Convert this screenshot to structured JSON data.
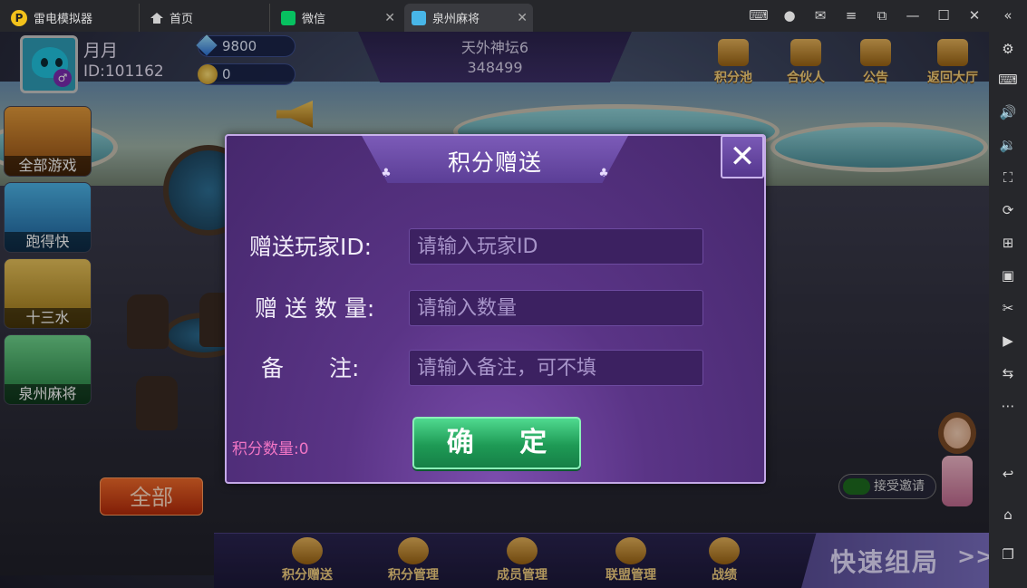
{
  "titlebar": {
    "tabs": [
      {
        "label": "雷电模拟器",
        "icon": "ldplayer-logo-icon"
      },
      {
        "label": "首页",
        "icon": "home-icon"
      },
      {
        "label": "微信",
        "icon": "wechat-icon"
      },
      {
        "label": "泉州麻将",
        "icon": "game-icon"
      }
    ]
  },
  "player": {
    "name": "月月",
    "id": "ID:101162",
    "diamonds": "9800",
    "coins": "0"
  },
  "room": {
    "name": "天外神坛6",
    "number": "348499"
  },
  "top_buttons": [
    "积分池",
    "合伙人",
    "公告",
    "返回大厅"
  ],
  "games": [
    "全部游戏",
    "跑得快",
    "十三水",
    "泉州麻将"
  ],
  "all_button": "全部",
  "dialog": {
    "title": "积分赠送",
    "close": "✕",
    "fields": [
      {
        "label": "赠送玩家ID:",
        "placeholder": "请输入玩家ID"
      },
      {
        "label": "赠 送 数 量:",
        "placeholder": "请输入数量"
      },
      {
        "label": "备　　注:",
        "placeholder": "请输入备注，可不填"
      }
    ],
    "points": "积分数量:0",
    "confirm": "确 定"
  },
  "invite": "接受邀请",
  "bottom_buttons": [
    "积分赠送",
    "积分管理",
    "成员管理",
    "联盟管理",
    "战绩"
  ],
  "quick_match": "快速组局",
  "quick_chevron": ">>",
  "colors": {
    "dialog_bg": "#5a3486",
    "confirm": "#1e9a55",
    "accent_gold": "#f4d080",
    "points_pink": "#f075c4"
  }
}
